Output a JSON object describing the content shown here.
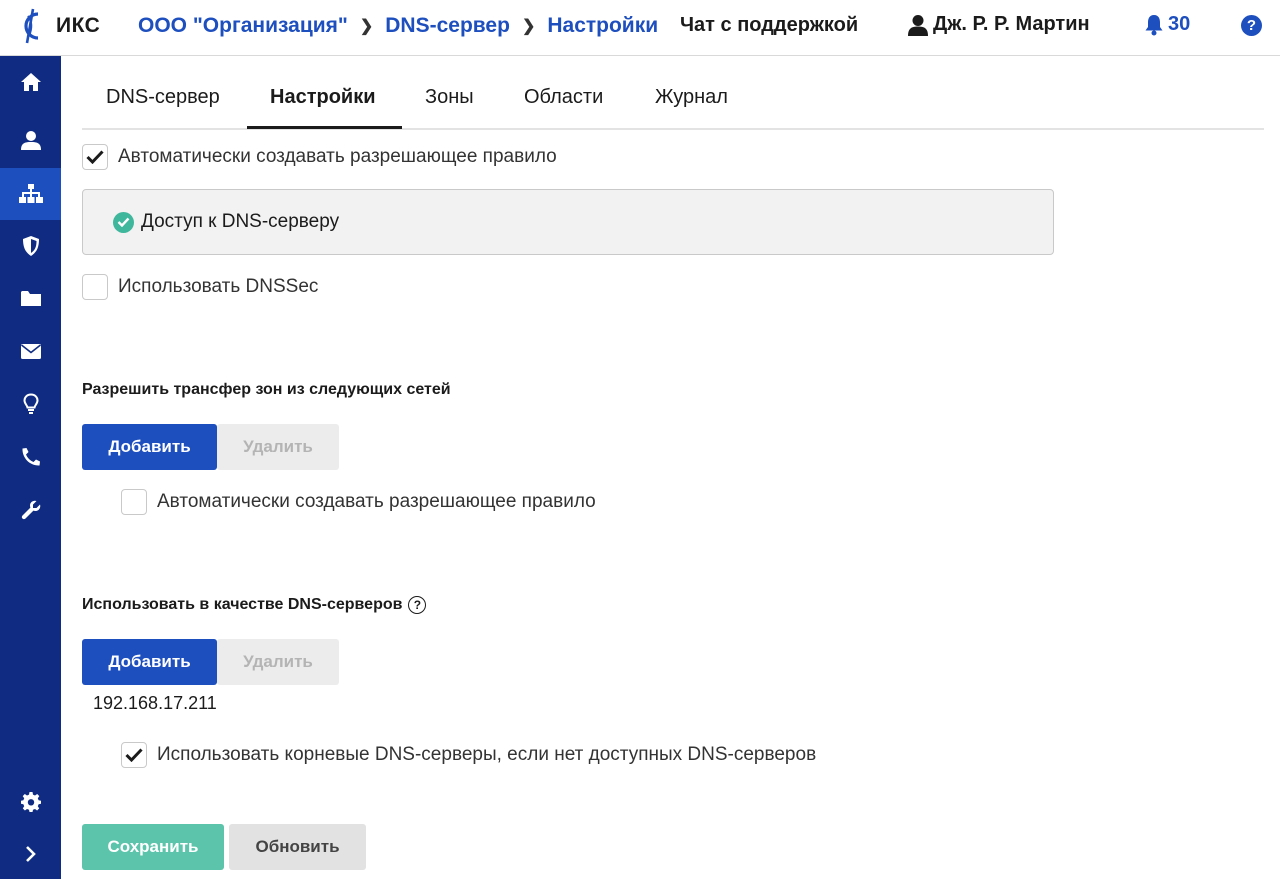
{
  "app": {
    "name": "ИКС"
  },
  "breadcrumbs": [
    {
      "label": "ООО \"Организация\""
    },
    {
      "label": "DNS-сервер"
    },
    {
      "label": "Настройки"
    }
  ],
  "header": {
    "support": "Чат с поддержкой",
    "user": "Дж. Р. Р. Мартин",
    "notifications": "30",
    "help": "?"
  },
  "sidebar": {
    "items": [
      {
        "icon": "home-icon"
      },
      {
        "icon": "user-icon"
      },
      {
        "icon": "network-icon",
        "active": true
      },
      {
        "icon": "shield-icon"
      },
      {
        "icon": "folder-icon"
      },
      {
        "icon": "mail-icon"
      },
      {
        "icon": "lightbulb-icon"
      },
      {
        "icon": "phone-icon"
      },
      {
        "icon": "wrench-icon"
      }
    ],
    "bottom": [
      {
        "icon": "gear-icon"
      },
      {
        "icon": "chevron-right-icon"
      }
    ]
  },
  "tabs": [
    {
      "label": "DNS-сервер"
    },
    {
      "label": "Настройки",
      "active": true
    },
    {
      "label": "Зоны"
    },
    {
      "label": "Области"
    },
    {
      "label": "Журнал"
    }
  ],
  "settings": {
    "auto_rule": {
      "label": "Автоматически создавать разрешающее правило",
      "checked": true
    },
    "rule_box": {
      "label": "Доступ к DNS-серверу",
      "status_icon": "check-circle-icon"
    },
    "dnssec": {
      "label": "Использовать DNSSec",
      "checked": false
    }
  },
  "zone_transfer": {
    "title": "Разрешить трансфер зон из следующих сетей",
    "add": "Добавить",
    "remove": "Удалить",
    "auto_rule": {
      "label": "Автоматически создавать разрешающее правило",
      "checked": false
    }
  },
  "dns_servers": {
    "title": "Использовать в качестве DNS-серверов",
    "help": "?",
    "add": "Добавить",
    "remove": "Удалить",
    "items": [
      "192.168.17.211"
    ],
    "root_servers": {
      "label": "Использовать корневые DNS-серверы, если нет доступных DNS-серверов",
      "checked": true
    }
  },
  "actions": {
    "save": "Сохранить",
    "refresh": "Обновить"
  },
  "colors": {
    "accent": "#1e4fbe",
    "sidebar": "#0f2c82",
    "success": "#3fb79c",
    "save": "#5bc4aa"
  }
}
